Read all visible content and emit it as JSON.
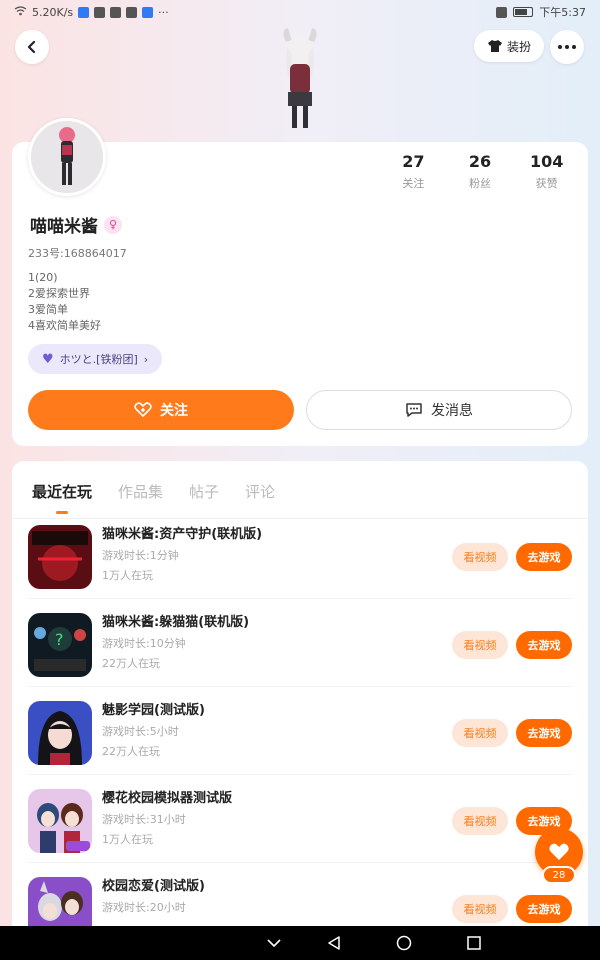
{
  "status_bar": {
    "speed": "5.20K/s",
    "dots": "···",
    "time": "下午5:37"
  },
  "header": {
    "dress_label": "装扮"
  },
  "profile": {
    "stats": [
      {
        "value": "27",
        "label": "关注"
      },
      {
        "value": "26",
        "label": "粉丝"
      },
      {
        "value": "104",
        "label": "获赞"
      }
    ],
    "username": "喵喵米酱",
    "uid": "233号:168864017",
    "bio": [
      "1(20)",
      "2爱探索世界",
      "3爱简单",
      "4喜欢简单美好"
    ],
    "fan_pill": "ホツと.[铁粉团]",
    "follow_label": "关注",
    "message_label": "发消息"
  },
  "tabs": [
    {
      "label": "最近在玩",
      "active": true
    },
    {
      "label": "作品集",
      "active": false
    },
    {
      "label": "帖子",
      "active": false
    },
    {
      "label": "评论",
      "active": false
    }
  ],
  "games": [
    {
      "title": "猫咪米酱:资产守护(联机版)",
      "sub1": "游戏时长:1分钟",
      "sub2": "1万人在玩",
      "light_btn": "看视频",
      "orange_btn": "去游戏"
    },
    {
      "title": "猫咪米酱:躲猫猫(联机版)",
      "sub1": "游戏时长:10分钟",
      "sub2": "22万人在玩",
      "light_btn": "看视频",
      "orange_btn": "去游戏"
    },
    {
      "title": "魅影学园(测试版)",
      "sub1": "游戏时长:5小时",
      "sub2": "22万人在玩",
      "light_btn": "看视频",
      "orange_btn": "去游戏"
    },
    {
      "title": "樱花校园模拟器测试版",
      "sub1": "游戏时长:31小时",
      "sub2": "1万人在玩",
      "light_btn": "看视频",
      "orange_btn": "去游戏"
    },
    {
      "title": "校园恋爱(测试版)",
      "sub1": "游戏时长:20小时",
      "sub2": "",
      "light_btn": "看视频",
      "orange_btn": "去游戏"
    }
  ],
  "like_count": "28",
  "colors": {
    "accent": "#ff7a1a",
    "accent_dark": "#ff6a00",
    "pill_bg": "#ece8fb"
  }
}
